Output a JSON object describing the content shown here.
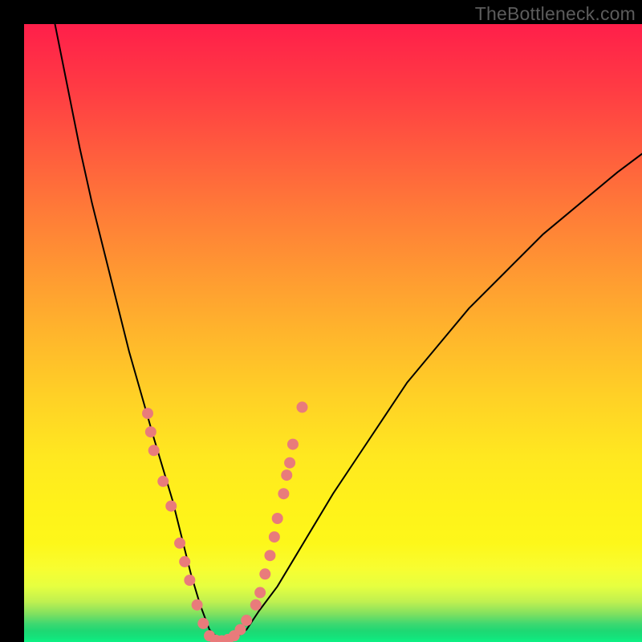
{
  "watermark": "TheBottleneck.com",
  "chart_data": {
    "type": "line",
    "title": "",
    "xlabel": "",
    "ylabel": "",
    "xlim": [
      0,
      100
    ],
    "ylim": [
      0,
      100
    ],
    "grid": false,
    "legend": false,
    "background_gradient": {
      "direction": "top-to-bottom",
      "stops": [
        {
          "pos": 0,
          "color": "#ff1f4a"
        },
        {
          "pos": 50,
          "color": "#ffb52c"
        },
        {
          "pos": 80,
          "color": "#fff21a"
        },
        {
          "pos": 96,
          "color": "#7fe060"
        },
        {
          "pos": 100,
          "color": "#0cf284"
        }
      ]
    },
    "series": [
      {
        "name": "bottleneck-curve",
        "color": "#000000",
        "stroke_width": 2,
        "x": [
          5,
          7,
          9,
          11,
          13,
          15,
          17,
          19,
          21,
          22.5,
          24,
          25.5,
          27,
          28.5,
          30,
          32,
          34,
          36,
          38,
          41,
          44,
          47,
          50,
          54,
          58,
          62,
          67,
          72,
          78,
          84,
          90,
          96,
          100
        ],
        "y": [
          100,
          90,
          80,
          71,
          63,
          55,
          47,
          40,
          33,
          28,
          23,
          17,
          11,
          6,
          2,
          0,
          0.5,
          2,
          5,
          9,
          14,
          19,
          24,
          30,
          36,
          42,
          48,
          54,
          60,
          66,
          71,
          76,
          79
        ]
      }
    ],
    "markers": {
      "name": "data-points",
      "color": "#e97b7b",
      "radius": 7,
      "points": [
        {
          "x": 20.0,
          "y": 37
        },
        {
          "x": 20.5,
          "y": 34
        },
        {
          "x": 21.0,
          "y": 31
        },
        {
          "x": 22.5,
          "y": 26
        },
        {
          "x": 23.8,
          "y": 22
        },
        {
          "x": 25.2,
          "y": 16
        },
        {
          "x": 26.0,
          "y": 13
        },
        {
          "x": 26.8,
          "y": 10
        },
        {
          "x": 28.0,
          "y": 6
        },
        {
          "x": 29.0,
          "y": 3
        },
        {
          "x": 30.0,
          "y": 1
        },
        {
          "x": 31.0,
          "y": 0.3
        },
        {
          "x": 32.0,
          "y": 0.2
        },
        {
          "x": 33.0,
          "y": 0.4
        },
        {
          "x": 34.0,
          "y": 1
        },
        {
          "x": 35.0,
          "y": 2
        },
        {
          "x": 36.0,
          "y": 3.5
        },
        {
          "x": 37.5,
          "y": 6
        },
        {
          "x": 38.2,
          "y": 8
        },
        {
          "x": 39.0,
          "y": 11
        },
        {
          "x": 39.8,
          "y": 14
        },
        {
          "x": 40.5,
          "y": 17
        },
        {
          "x": 41.0,
          "y": 20
        },
        {
          "x": 42.0,
          "y": 24
        },
        {
          "x": 42.5,
          "y": 27
        },
        {
          "x": 43.0,
          "y": 29
        },
        {
          "x": 43.5,
          "y": 32
        },
        {
          "x": 45.0,
          "y": 38
        }
      ]
    }
  }
}
